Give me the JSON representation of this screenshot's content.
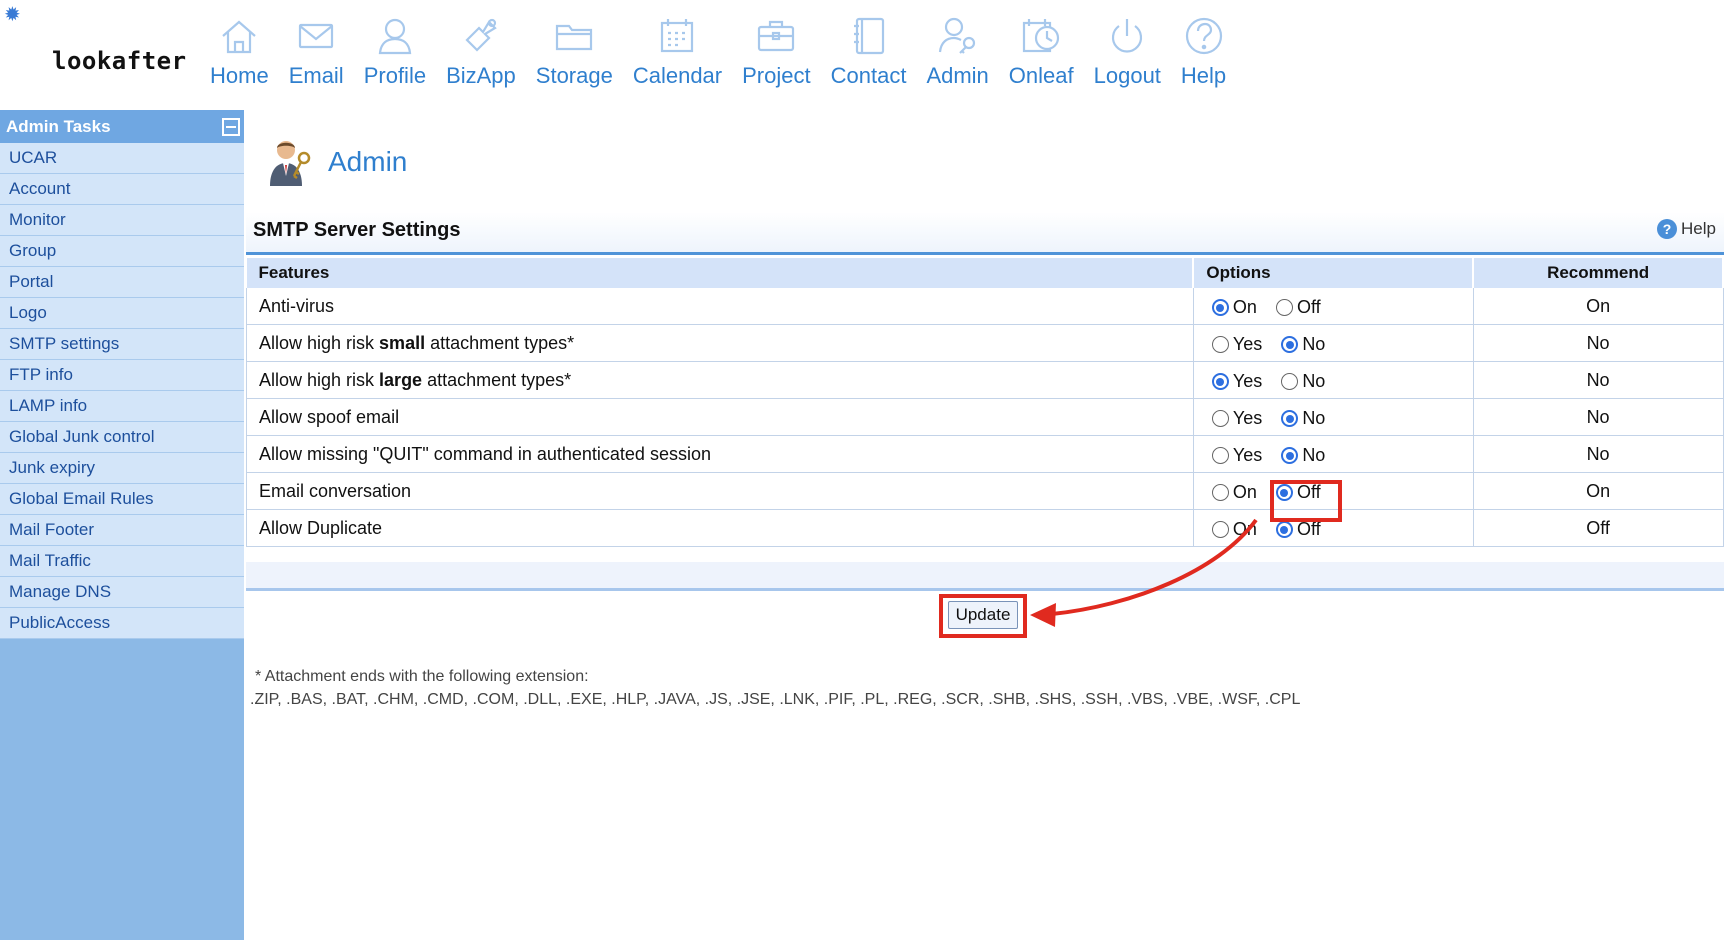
{
  "app": {
    "logo": "lookafter"
  },
  "nav": [
    {
      "label": "Home",
      "icon": "home-icon"
    },
    {
      "label": "Email",
      "icon": "email-icon"
    },
    {
      "label": "Profile",
      "icon": "profile-icon"
    },
    {
      "label": "BizApp",
      "icon": "bizapp-icon"
    },
    {
      "label": "Storage",
      "icon": "storage-icon"
    },
    {
      "label": "Calendar",
      "icon": "calendar-icon"
    },
    {
      "label": "Project",
      "icon": "project-icon"
    },
    {
      "label": "Contact",
      "icon": "contact-icon"
    },
    {
      "label": "Admin",
      "icon": "admin-icon"
    },
    {
      "label": "Onleaf",
      "icon": "onleaf-icon"
    },
    {
      "label": "Logout",
      "icon": "logout-icon"
    },
    {
      "label": "Help",
      "icon": "help-icon"
    }
  ],
  "sidebar": {
    "title": "Admin Tasks",
    "items": [
      "UCAR",
      "Account",
      "Monitor",
      "Group",
      "Portal",
      "Logo",
      "SMTP settings",
      "FTP info",
      "LAMP info",
      "Global Junk control",
      "Junk expiry",
      "Global Email Rules",
      "Mail Footer",
      "Mail Traffic",
      "Manage DNS",
      "PublicAccess"
    ]
  },
  "page": {
    "title": "Admin"
  },
  "section": {
    "title": "SMTP Server Settings",
    "help_label": "Help"
  },
  "table": {
    "headers": {
      "features": "Features",
      "options": "Options",
      "recommend": "Recommend"
    },
    "rows": [
      {
        "feature": "Anti-virus",
        "opt1": "On",
        "opt2": "Off",
        "selected": "On",
        "recommend": "On"
      },
      {
        "feature_pre": "Allow high risk ",
        "feature_bold": "small",
        "feature_post": " attachment types*",
        "opt1": "Yes",
        "opt2": "No",
        "selected": "No",
        "recommend": "No"
      },
      {
        "feature_pre": "Allow high risk ",
        "feature_bold": "large",
        "feature_post": " attachment types*",
        "opt1": "Yes",
        "opt2": "No",
        "selected": "Yes",
        "recommend": "No"
      },
      {
        "feature": "Allow spoof email",
        "opt1": "Yes",
        "opt2": "No",
        "selected": "No",
        "recommend": "No"
      },
      {
        "feature": "Allow missing \"QUIT\" command in authenticated session",
        "opt1": "Yes",
        "opt2": "No",
        "selected": "No",
        "recommend": "No"
      },
      {
        "feature": "Email conversation",
        "opt1": "On",
        "opt2": "Off",
        "selected": "Off",
        "recommend": "On"
      },
      {
        "feature": "Allow Duplicate",
        "opt1": "On",
        "opt2": "Off",
        "selected": "Off",
        "recommend": "Off"
      }
    ]
  },
  "update_label": "Update",
  "note": {
    "line1": "* Attachment ends with the following extension:",
    "line2": ".ZIP, .BAS, .BAT, .CHM, .CMD, .COM, .DLL, .EXE, .HLP, .JAVA, .JS, .JSE, .LNK, .PIF, .PL, .REG, .SCR, .SHB, .SHS, .SSH, .VBS, .VBE, .WSF, .CPL"
  },
  "colors": {
    "accent": "#2f7fce",
    "sidebar": "#8cb9e6",
    "highlight": "#e02a1f",
    "radio": "#2d6fe0"
  }
}
